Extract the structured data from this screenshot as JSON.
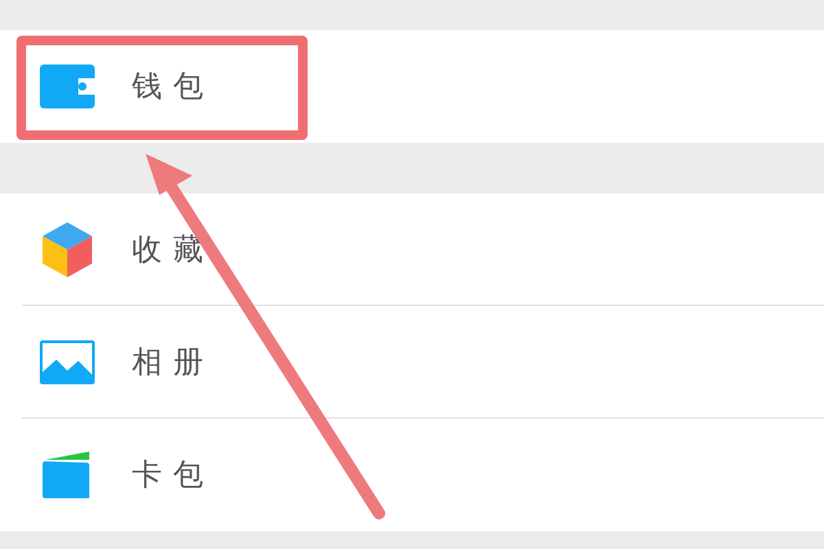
{
  "sections": [
    {
      "items": [
        {
          "kind": "wallet",
          "label": "钱包",
          "highlighted": true
        }
      ]
    },
    {
      "items": [
        {
          "kind": "favorites",
          "label": "收藏",
          "highlighted": false
        },
        {
          "kind": "album",
          "label": "相册",
          "highlighted": false
        },
        {
          "kind": "cards",
          "label": "卡包",
          "highlighted": false
        }
      ]
    }
  ]
}
